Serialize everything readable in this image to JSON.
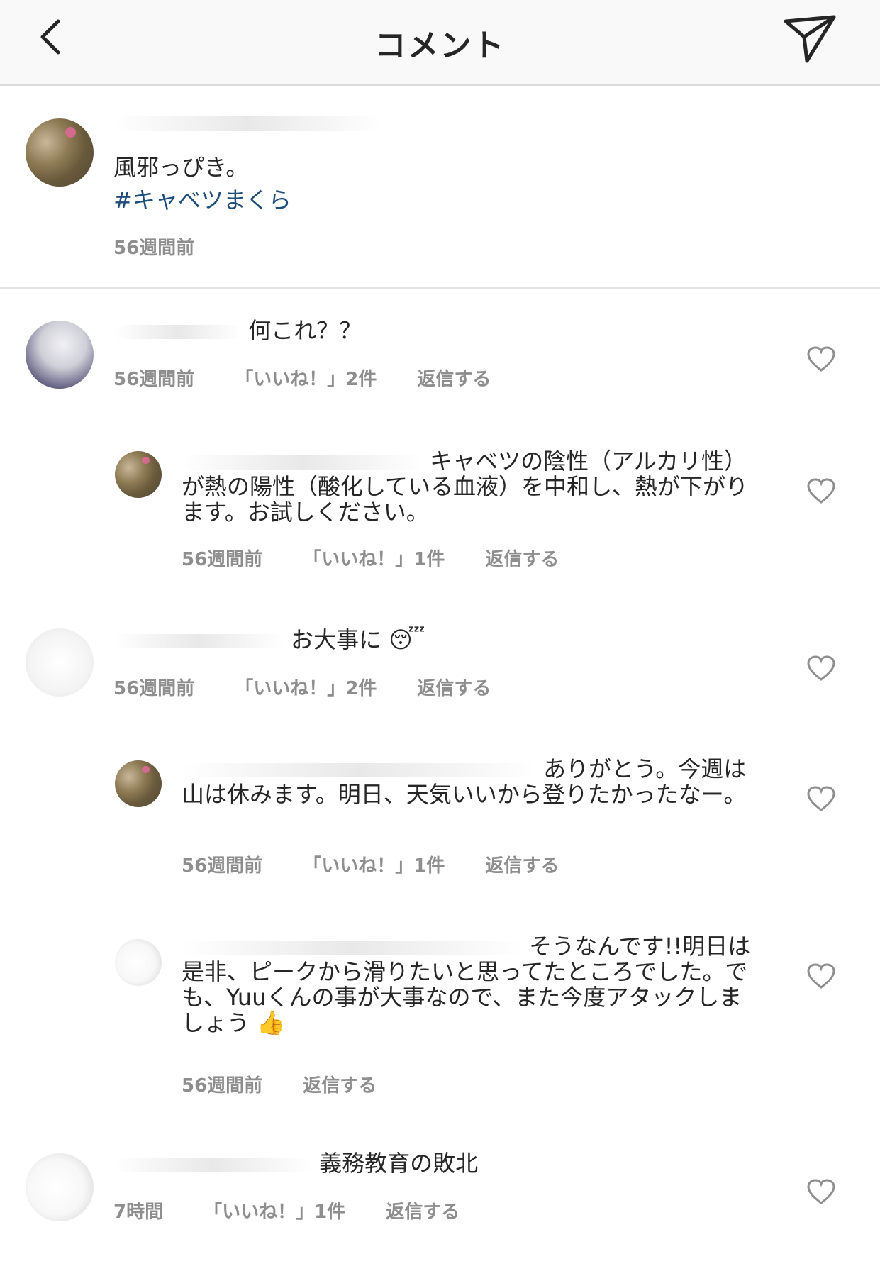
{
  "header": {
    "title": "コメント",
    "back_icon": "chevron-left-icon",
    "send_icon": "paper-plane-icon"
  },
  "caption": {
    "text": "風邪っぴき。",
    "hashtag": "#キャベツまくら",
    "time": "56週間前"
  },
  "comments": [
    {
      "text": "何これ？？",
      "time": "56週間前",
      "likes": "「いいね！」2件",
      "reply": "返信する"
    },
    {
      "text": "キャベツの陰性（アルカリ性）が熱の陽性（酸化している血液）を中和し、熱が下がります。お試しください。",
      "time": "56週間前",
      "likes": "「いいね！」1件",
      "reply": "返信する"
    },
    {
      "text": "お大事に",
      "emoji": "😴",
      "time": "56週間前",
      "likes": "「いいね！」2件",
      "reply": "返信する"
    },
    {
      "text": "ありがとう。今週は山は休みます。明日、天気いいから登りたかったなー。",
      "time": "56週間前",
      "likes": "「いいね！」1件",
      "reply": "返信する"
    },
    {
      "text": "そうなんです!!明日は是非、ピークから滑りたいと思ってたところでした。でも、Yuuくんの事が大事なので、また今度アタックしましょう",
      "emoji": "👍",
      "time": "56週間前",
      "reply": "返信する"
    },
    {
      "text": "義務教育の敗北",
      "time": "7時間",
      "likes": "「いいね！」1件",
      "reply": "返信する"
    }
  ],
  "colors": {
    "hashtag": "#1e4d7a",
    "meta": "#8e8e8e",
    "text": "#262626",
    "header_bg": "#f9f9f9"
  }
}
